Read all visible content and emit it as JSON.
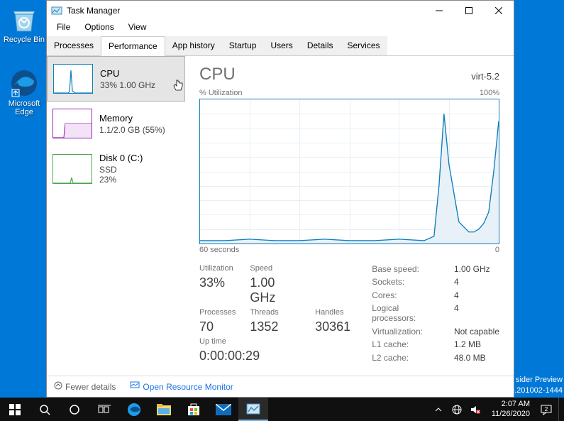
{
  "desktop": {
    "icons": [
      {
        "label": "Recycle Bin",
        "id": "recycle-bin"
      },
      {
        "label": "Microsoft Edge",
        "id": "edge"
      }
    ]
  },
  "window": {
    "title": "Task Manager",
    "menus": [
      "File",
      "Options",
      "View"
    ],
    "tabs": [
      "Processes",
      "Performance",
      "App history",
      "Startup",
      "Users",
      "Details",
      "Services"
    ],
    "active_tab": 1
  },
  "sidebar": {
    "items": [
      {
        "title": "CPU",
        "sub": "33%  1.00 GHz",
        "color": "#117dbb"
      },
      {
        "title": "Memory",
        "sub": "1.1/2.0 GB (55%)",
        "color": "#9528b4"
      },
      {
        "title": "Disk 0 (C:)",
        "sub": "SSD",
        "sub2": "23%",
        "color": "#4ca64c"
      }
    ],
    "active": 0
  },
  "details": {
    "title": "CPU",
    "right": "virt-5.2",
    "axis_top_left": "% Utilization",
    "axis_top_right": "100%",
    "axis_bottom_left": "60 seconds",
    "axis_bottom_right": "0"
  },
  "stats_main": {
    "util_lbl": "Utilization",
    "util_val": "33%",
    "speed_lbl": "Speed",
    "speed_val": "1.00 GHz",
    "proc_lbl": "Processes",
    "proc_val": "70",
    "thr_lbl": "Threads",
    "thr_val": "1352",
    "hnd_lbl": "Handles",
    "hnd_val": "30361",
    "up_lbl": "Up time",
    "up_val": "0:00:00:29"
  },
  "stats_side": [
    {
      "lbl": "Base speed:",
      "val": "1.00 GHz"
    },
    {
      "lbl": "Sockets:",
      "val": "4"
    },
    {
      "lbl": "Cores:",
      "val": "4"
    },
    {
      "lbl": "Logical processors:",
      "val": "4"
    },
    {
      "lbl": "Virtualization:",
      "val": "Not capable"
    },
    {
      "lbl": "L1 cache:",
      "val": "1.2 MB"
    },
    {
      "lbl": "L2 cache:",
      "val": "48.0 MB"
    }
  ],
  "footer": {
    "fewer": "Fewer details",
    "resmon": "Open Resource Monitor"
  },
  "tray": {
    "time": "2:07 AM",
    "date": "11/26/2020"
  },
  "preview": {
    "line1": "sider Preview",
    "line2": "e.201002-1444"
  },
  "chart_data": {
    "type": "line",
    "title": "% Utilization",
    "xlabel": "seconds",
    "ylabel": "%",
    "ylim": [
      0,
      100
    ],
    "xlim": [
      60,
      0
    ],
    "x": [
      60,
      55,
      50,
      45,
      40,
      35,
      30,
      25,
      20,
      15,
      13,
      12,
      11,
      10,
      8,
      6,
      5,
      4,
      3,
      2,
      1,
      0
    ],
    "values": [
      2,
      2,
      3,
      2,
      2,
      3,
      2,
      2,
      3,
      2,
      5,
      40,
      90,
      55,
      15,
      8,
      8,
      10,
      14,
      22,
      50,
      85
    ]
  }
}
